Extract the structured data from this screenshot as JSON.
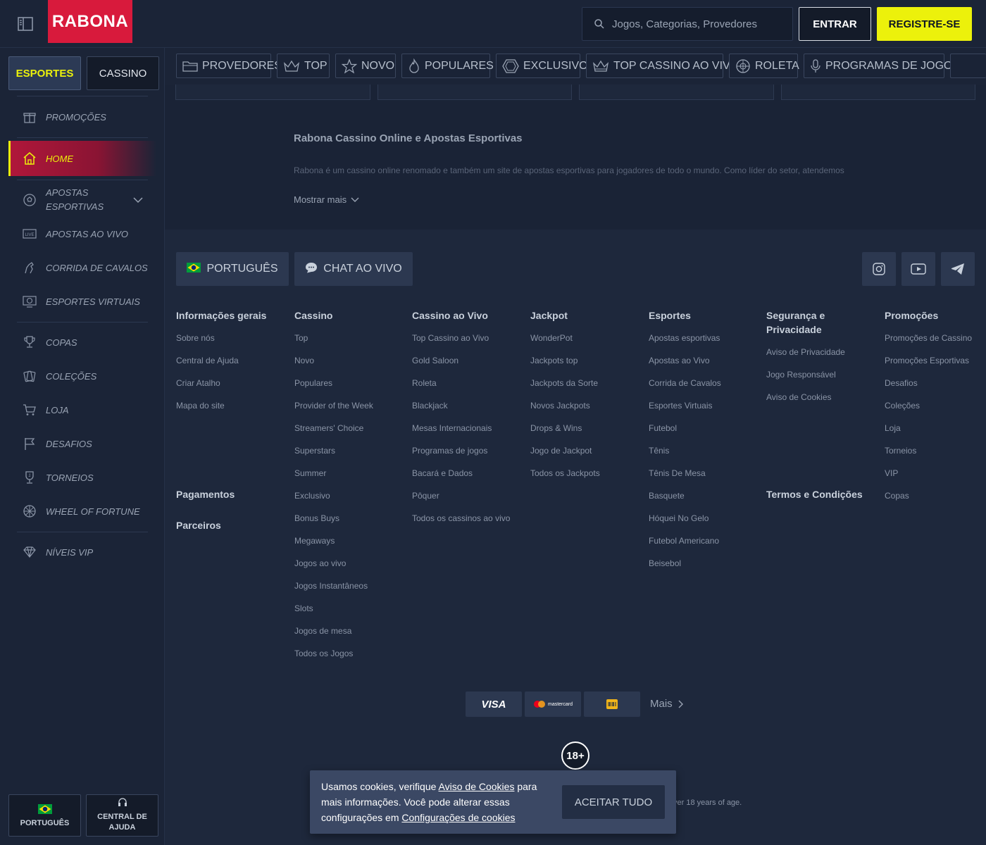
{
  "header": {
    "logo": "RABONA",
    "search_placeholder": "Jogos, Categorias, Provedores",
    "login": "ENTRAR",
    "register": "REGISTRE-SE"
  },
  "sidebar": {
    "tabs": [
      "ESPORTES",
      "CASSINO"
    ],
    "items": [
      {
        "label": "PROMOÇÕES",
        "icon": "gift-icon"
      },
      {
        "label": "HOME",
        "icon": "home-icon"
      },
      {
        "label": "APOSTAS ESPORTIVAS",
        "icon": "soccer-ball-icon"
      },
      {
        "label": "APOSTAS AO VIVO",
        "icon": "live-icon",
        "badge": "LIVE"
      },
      {
        "label": "CORRIDA DE CAVALOS",
        "icon": "horse-icon"
      },
      {
        "label": "ESPORTES VIRTUAIS",
        "icon": "virtual-sports-icon"
      },
      {
        "label": "COPAS",
        "icon": "trophy-icon"
      },
      {
        "label": "COLEÇÕES",
        "icon": "collections-icon"
      },
      {
        "label": "LOJA",
        "icon": "cart-icon"
      },
      {
        "label": "DESAFIOS",
        "icon": "flag-icon"
      },
      {
        "label": "TORNEIOS",
        "icon": "tournament-icon"
      },
      {
        "label": "WHEEL OF FORTUNE",
        "icon": "wheel-icon"
      },
      {
        "label": "NÍVEIS VIP",
        "icon": "diamond-icon"
      }
    ],
    "bottom": {
      "language": "PORTUGUÊS",
      "help": "CENTRAL DE AJUDA"
    }
  },
  "categories": [
    {
      "label": "PROVEDORES",
      "icon": "folder-icon"
    },
    {
      "label": "TOP",
      "icon": "crown-icon"
    },
    {
      "label": "NOVO",
      "icon": "star-icon"
    },
    {
      "label": "POPULARES",
      "icon": "flame-icon"
    },
    {
      "label": "EXCLUSIVO",
      "icon": "hexagon-icon"
    },
    {
      "label": "TOP CASSINO AO VIVO",
      "icon": "crown-icon"
    },
    {
      "label": "ROLETA",
      "icon": "roulette-icon"
    },
    {
      "label": "PROGRAMAS DE JOGOS",
      "icon": "microphone-icon"
    }
  ],
  "seo": {
    "title": "Rabona Cassino Online e Apostas Esportivas",
    "text": "Rabona é um cassino online renomado e também um site de apostas esportivas para jogadores de todo o mundo. Como líder do setor, atendemos",
    "show_more": "Mostrar mais"
  },
  "footer": {
    "language": "PORTUGUÊS",
    "chat": "CHAT AO VIVO",
    "columns": [
      {
        "title": "Informações gerais",
        "links": [
          "Sobre nós",
          "Central de Ajuda",
          "Criar Atalho",
          "Mapa do site"
        ]
      },
      {
        "title": "Cassino",
        "links": [
          "Top",
          "Novo",
          "Populares",
          "Provider of the Week",
          "Streamers' Choice",
          "Superstars",
          "Summer",
          "Exclusivo",
          "Bonus Buys",
          "Megaways",
          "Jogos ao vivo",
          "Jogos Instantâneos",
          "Slots",
          "Jogos de mesa",
          "Todos os Jogos"
        ]
      },
      {
        "title": "Cassino ao Vivo",
        "links": [
          "Top Cassino ao Vivo",
          "Gold Saloon",
          "Roleta",
          "Blackjack",
          "Mesas Internacionais",
          "Programas de jogos",
          "Bacará e Dados",
          "Pôquer",
          "Todos os cassinos ao vivo"
        ]
      },
      {
        "title": "Jackpot",
        "links": [
          "WonderPot",
          "Jackpots top",
          "Jackpots da Sorte",
          "Novos Jackpots",
          "Drops & Wins",
          "Jogo de Jackpot",
          "Todos os Jackpots"
        ]
      },
      {
        "title": "Esportes",
        "links": [
          "Apostas esportivas",
          "Apostas ao Vivo",
          "Corrida de Cavalos",
          "Esportes Virtuais",
          "Futebol",
          "Tênis",
          "Tênis De Mesa",
          "Basquete",
          "Hóquei No Gelo",
          "Futebol Americano",
          "Beisebol"
        ]
      },
      {
        "title": "Segurança e Privacidade",
        "links": [
          "Aviso de Privacidade",
          "Jogo Responsável",
          "Aviso de Cookies"
        ]
      },
      {
        "title": "Promoções",
        "links": [
          "Promoções de Cassino",
          "Promoções Esportivas",
          "Desafios",
          "Coleções",
          "Loja",
          "Torneios",
          "VIP",
          "Copas"
        ]
      }
    ],
    "extra_headings": {
      "payments": "Pagamentos",
      "partners": "Parceiros",
      "terms": "Termos e Condições"
    },
    "payments": [
      "VISA",
      "mastercard"
    ],
    "more_payments": "Mais",
    "age_badge": "18+",
    "age_text": "ver 18 years of age."
  },
  "cookie": {
    "text_before": "Usamos cookies, verifique ",
    "link1": "Aviso de Cookies",
    "text_middle": " para mais informações. Você pode alterar essas configurações em ",
    "link2": "Configurações de cookies",
    "button": "ACEITAR TUDO"
  },
  "colors": {
    "brand_red": "#d81a3c",
    "accent_yellow": "#ecf10b",
    "bg": "#1a2336"
  }
}
